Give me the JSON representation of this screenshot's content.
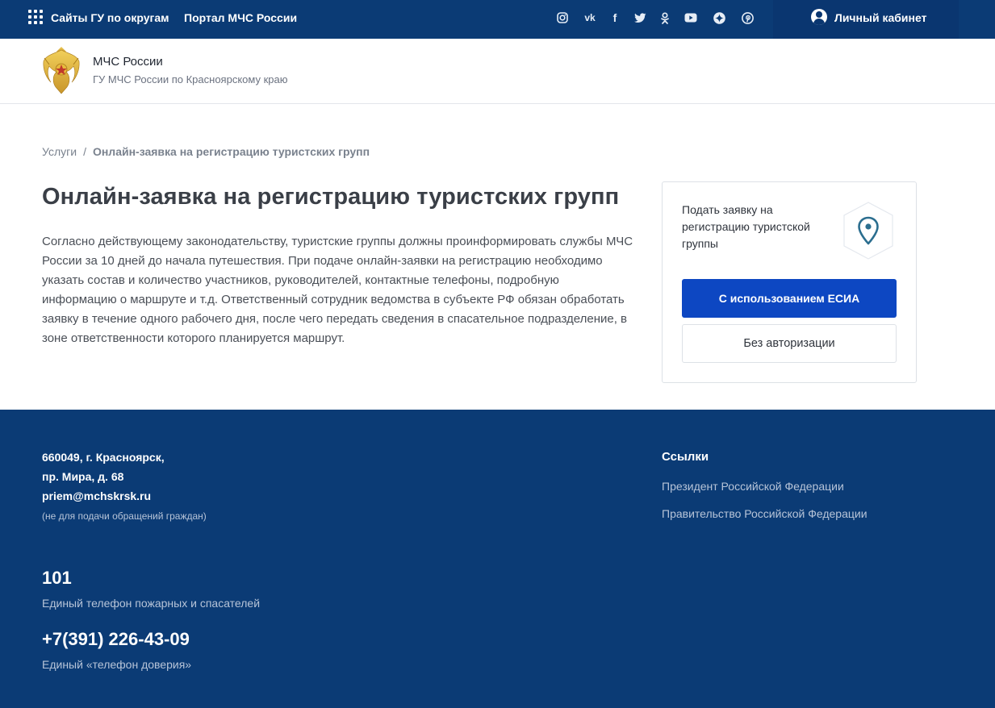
{
  "topbar": {
    "regions_link": "Сайты ГУ по округам",
    "portal_link": "Портал МЧС России",
    "social_icons": [
      "instagram-icon",
      "vk-icon",
      "facebook-icon",
      "twitter-icon",
      "odnoklassniki-icon",
      "youtube-icon",
      "zen-icon",
      "pinterest-icon"
    ],
    "cabinet_label": "Личный кабинет"
  },
  "header": {
    "org_name": "МЧС России",
    "org_sub": "ГУ МЧС России по Красноярскому краю"
  },
  "breadcrumb": {
    "root": "Услуги",
    "separator": "/",
    "current": "Онлайн-заявка на регистрацию туристских групп"
  },
  "main": {
    "title": "Онлайн-заявка на регистрацию туристских групп",
    "description": "Согласно действующему законодательству, туристские группы должны проинформировать службы МЧС России за 10 дней до начала путешествия. При подаче онлайн-заявки на регистрацию необходимо указать состав и количество участников, руководителей, контактные телефоны, подробную информацию о маршруте и т.д. Ответственный сотрудник ведомства в субъекте РФ обязан обработать заявку в течение одного рабочего дня, после чего передать сведения в спасательное подразделение, в зоне ответственности которого планируется маршрут."
  },
  "card": {
    "title": "Подать заявку на регистрацию туристской группы",
    "icon": "location-pin-icon",
    "primary_button": "С использованием ЕСИА",
    "secondary_button": "Без авторизации"
  },
  "footer": {
    "address_line1": "660049, г. Красноярск,",
    "address_line2": "пр. Мира, д. 68",
    "email": "priem@mchskrsk.ru",
    "email_note": "(не для подачи обращений граждан)",
    "phone1": "101",
    "phone1_desc": "Единый телефон пожарных и спасателей",
    "phone2": "+7(391) 226-43-09",
    "phone2_desc": "Единый «телефон доверия»",
    "links_title": "Ссылки",
    "links": [
      "Президент Российской Федерации",
      "Правительство Российской Федерации"
    ]
  },
  "colors": {
    "brand_dark": "#0b3b75",
    "primary_button": "#0d47c2",
    "accent_pin": "#2b6e8f"
  }
}
